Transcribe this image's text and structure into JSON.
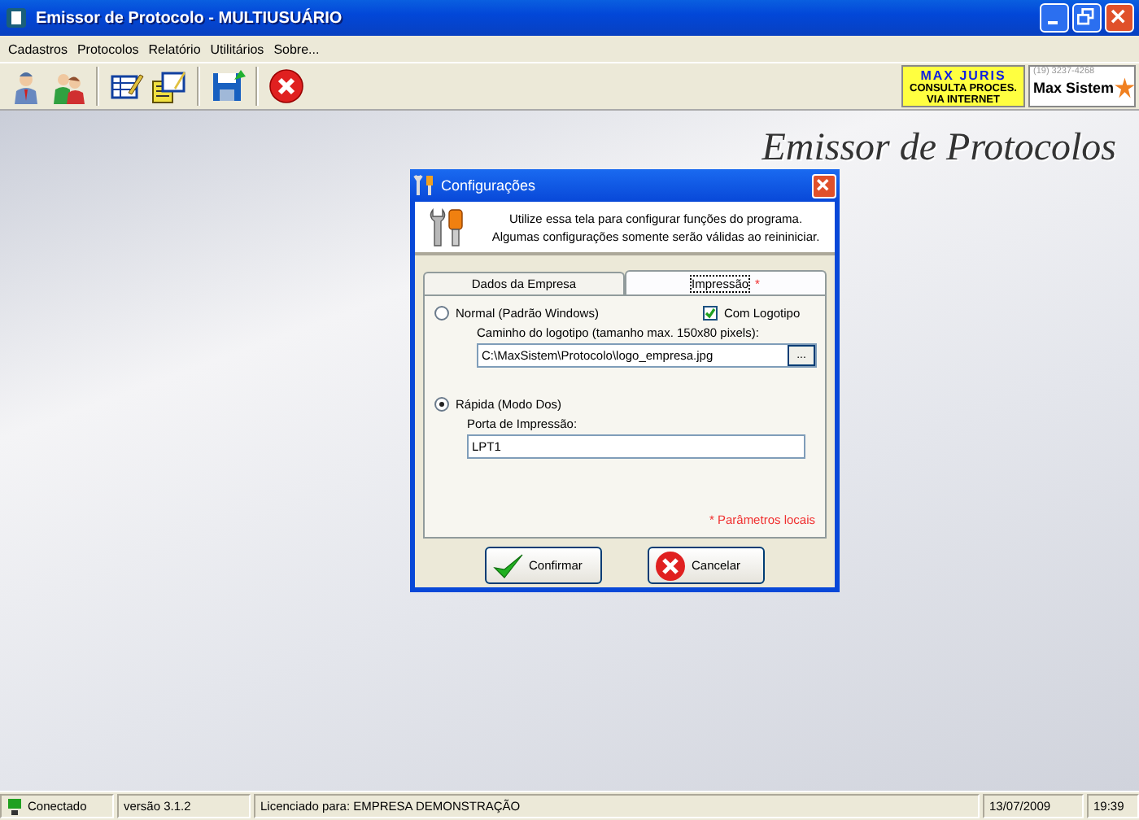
{
  "window": {
    "title": "Emissor de Protocolo - MULTIUSUÁRIO"
  },
  "menu": [
    "Cadastros",
    "Protocolos",
    "Relatório",
    "Utilitários",
    "Sobre..."
  ],
  "toolbar": [
    {
      "kind": "user"
    },
    {
      "kind": "users"
    },
    {
      "kind": "sep"
    },
    {
      "kind": "form"
    },
    {
      "kind": "forms"
    },
    {
      "kind": "sep"
    },
    {
      "kind": "save"
    },
    {
      "kind": "sep"
    },
    {
      "kind": "exit"
    }
  ],
  "banners": {
    "juris": {
      "title": "MAX JURIS",
      "lines": [
        "CONSULTA PROCES.",
        "VIA INTERNET"
      ]
    },
    "sistem": {
      "phone": "(19) 3237-4268",
      "name": "Max Sistem"
    }
  },
  "background_title": "Emissor de Protocolos",
  "dialog": {
    "title": "Configurações",
    "info": [
      "Utilize essa tela para configurar funções do programa.",
      "Algumas configurações somente serão válidas ao reininiciar."
    ],
    "tabs": [
      {
        "label": "Dados da Empresa",
        "selected": false
      },
      {
        "label": "Impressão",
        "selected": true,
        "marker": "*"
      }
    ],
    "modes": [
      {
        "label": "Normal (Padrão Windows)",
        "selected": false
      },
      {
        "label": "Rápida (Modo Dos)",
        "selected": true
      }
    ],
    "logo_checkbox": {
      "label": "Com Logotipo",
      "checked": true
    },
    "logo_path": {
      "label": "Caminho do logotipo (tamanho max. 150x80 pixels):",
      "value": "C:\\MaxSistem\\Protocolo\\logo_empresa.jpg",
      "browse": "..."
    },
    "port": {
      "label": "Porta de Impressão:",
      "value": "LPT1"
    },
    "note": "* Parâmetros locais",
    "buttons": [
      {
        "kind": "confirm",
        "label": "Confirmar"
      },
      {
        "kind": "cancel",
        "label": "Cancelar"
      }
    ]
  },
  "status_bar": [
    "Conectado",
    "versão 3.1.2",
    "Licenciado para: EMPRESA DEMONSTRAÇÃO",
    "13/07/2009",
    "19:39"
  ]
}
